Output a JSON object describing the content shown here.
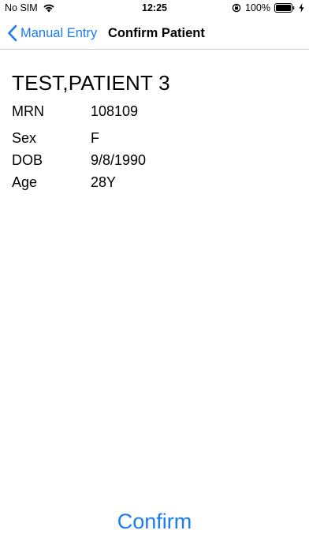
{
  "status_bar": {
    "carrier": "No SIM",
    "time": "12:25",
    "battery_percent": "100%",
    "icons": [
      "wifi-icon",
      "orientation-lock-icon",
      "battery-icon",
      "charging-icon"
    ]
  },
  "nav": {
    "back_label": "Manual Entry",
    "title": "Confirm Patient"
  },
  "patient": {
    "name": "TEST,PATIENT 3",
    "fields": [
      {
        "label": "MRN",
        "value": "108109"
      },
      {
        "label": "Sex",
        "value": "F"
      },
      {
        "label": "DOB",
        "value": "9/8/1990"
      },
      {
        "label": "Age",
        "value": "28Y"
      }
    ]
  },
  "actions": {
    "confirm_label": "Confirm"
  },
  "colors": {
    "accent": "#1a7cf0"
  }
}
